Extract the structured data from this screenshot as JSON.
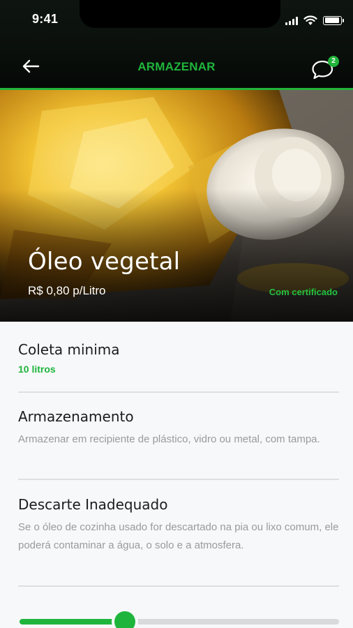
{
  "status_bar": {
    "time": "9:41"
  },
  "header": {
    "title": "ARMAZENAR",
    "chat_badge_count": "2"
  },
  "product": {
    "name": "Óleo vegetal",
    "price": "R$ 0,80 p/Litro",
    "certificate": "Com certificado"
  },
  "sections": [
    {
      "title": "Coleta minima",
      "value": "10 litros"
    },
    {
      "title": "Armazenamento",
      "text": "Armazenar em recipiente de plástico, vidro ou metal, com tampa."
    },
    {
      "title": "Descarte Inadequado",
      "text": "Se o óleo de cozinha usado for descartado na pia ou lixo comum, ele poderá contaminar a água, o solo e a atmosfera."
    }
  ],
  "progress": {
    "fraction": 0.33
  },
  "colors": {
    "accent": "#1fb53c",
    "dark": "#0a0f0b",
    "muted_text": "#9a9a9a"
  },
  "icons": {
    "back": "arrow-left-icon",
    "chat": "chat-bubble-icon"
  }
}
